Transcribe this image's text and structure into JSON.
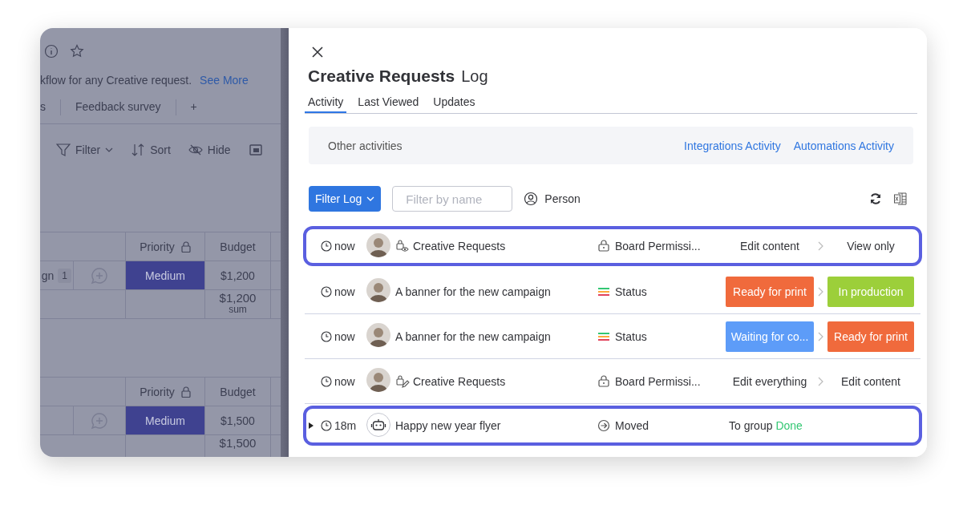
{
  "board": {
    "description": "kflow for any Creative request.",
    "see_more": "See More",
    "views": [
      {
        "label": "s"
      },
      {
        "label": "Feedback survey"
      },
      {
        "label": "+"
      }
    ],
    "toolbar": [
      {
        "kind": "filter",
        "label": "Filter"
      },
      {
        "kind": "sort",
        "label": "Sort"
      },
      {
        "kind": "hide",
        "label": "Hide"
      },
      {
        "kind": "layout"
      }
    ],
    "groups": [
      {
        "columns": [
          "Priority",
          "Budget"
        ],
        "rows": [
          {
            "item": "gn",
            "badge": "1",
            "priority": "Medium",
            "budget": "$1,200"
          }
        ],
        "summary": {
          "value": "$1,200",
          "label": "sum"
        }
      },
      {
        "columns": [
          "Priority",
          "Budget"
        ],
        "rows": [
          {
            "priority": "Medium",
            "budget": "$1,500"
          }
        ],
        "summary": {
          "value": "$1,500"
        }
      }
    ]
  },
  "panel": {
    "title": "Creative Requests",
    "subtitle": "Log",
    "tabs": [
      {
        "label": "Activity",
        "selected": true
      },
      {
        "label": "Last Viewed",
        "selected": false
      },
      {
        "label": "Updates",
        "selected": false
      }
    ],
    "other": {
      "label": "Other activities",
      "links": [
        "Integrations Activity",
        "Automations Activity"
      ]
    },
    "filter_button": "Filter Log",
    "filter_field": {
      "placeholder": "Filter by name"
    },
    "person_filter": "Person",
    "entries": [
      {
        "highlighted": true,
        "time": "now",
        "actor": {
          "kind": "person"
        },
        "item": {
          "kind": "view",
          "label": "Creative Requests"
        },
        "column": {
          "kind": "permission",
          "label": "Board Permissi..."
        },
        "from": {
          "text": "Edit content"
        },
        "to": {
          "text": "View only"
        }
      },
      {
        "highlighted": false,
        "time": "now",
        "actor": {
          "kind": "person"
        },
        "item": {
          "label": "A banner for the new campaign"
        },
        "column": {
          "kind": "status",
          "label": "Status"
        },
        "from": {
          "text": "Ready for print",
          "color": "#f06a3c"
        },
        "to": {
          "text": "In production",
          "color": "#9ccf3a"
        }
      },
      {
        "highlighted": false,
        "time": "now",
        "actor": {
          "kind": "person"
        },
        "item": {
          "label": "A banner for the new campaign"
        },
        "column": {
          "kind": "status",
          "label": "Status"
        },
        "from": {
          "text": "Waiting for co...",
          "color": "#5d9cf8"
        },
        "to": {
          "text": "Ready for print",
          "color": "#f06a3c"
        }
      },
      {
        "highlighted": false,
        "time": "now",
        "actor": {
          "kind": "person"
        },
        "item": {
          "kind": "edit",
          "label": "Creative Requests"
        },
        "column": {
          "kind": "permission",
          "label": "Board Permissi..."
        },
        "from": {
          "text": "Edit everything"
        },
        "to": {
          "text": "Edit content"
        }
      },
      {
        "highlighted": true,
        "expanded": false,
        "time": "18m",
        "actor": {
          "kind": "bot"
        },
        "item": {
          "label": "Happy new year flyer"
        },
        "column": {
          "kind": "moved",
          "label": "Moved"
        },
        "change": {
          "label": "To group",
          "group": "Done",
          "color": "#33c773"
        }
      }
    ]
  }
}
